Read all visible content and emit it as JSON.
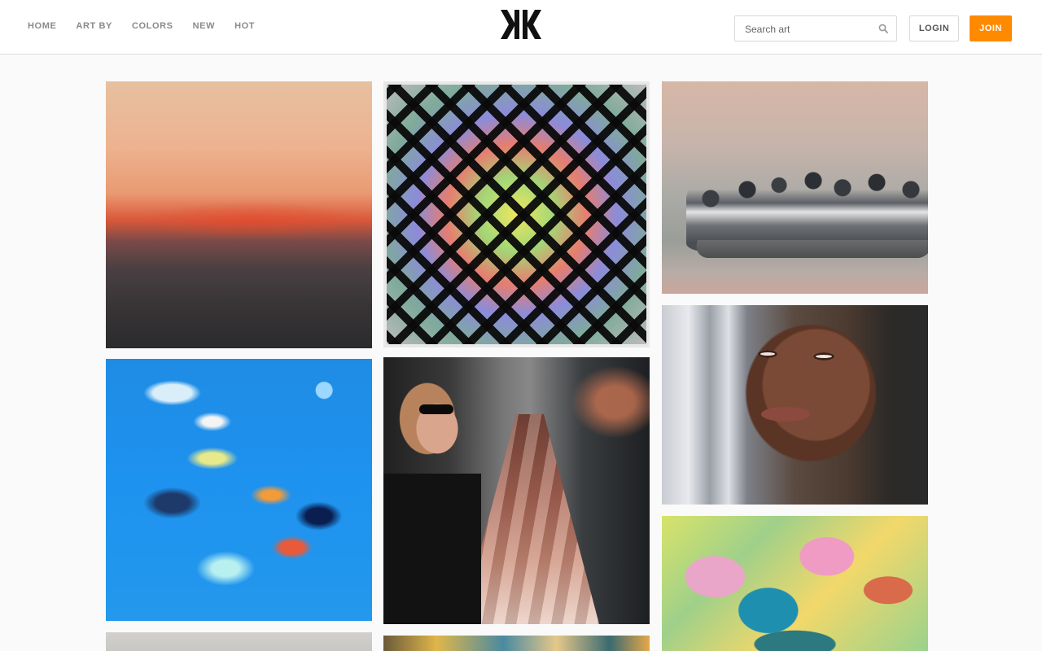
{
  "nav": {
    "items": [
      "HOME",
      "ART BY",
      "COLORS",
      "NEW",
      "HOT"
    ]
  },
  "logo": {
    "icon": "site-logo-mark"
  },
  "search": {
    "placeholder": "Search art",
    "value": "",
    "icon": "search-icon"
  },
  "actions": {
    "login": "LOGIN",
    "join": "JOIN"
  },
  "colors": {
    "accent": "#ff8a00",
    "nav_text": "#8a8a8a",
    "page_bg": "#fafafa"
  },
  "gallery": {
    "artworks": [
      {
        "subject": "sunset seascape painting"
      },
      {
        "subject": "rainbow geometric string art"
      },
      {
        "subject": "figures in a boat painting"
      },
      {
        "subject": "blue abstract figures painting"
      },
      {
        "subject": "woman with sunglasses and hallway painting"
      },
      {
        "subject": "portrait of a woman painting"
      },
      {
        "subject": "colorful cubist face painting"
      },
      {
        "subject": "grey artwork (partially visible)"
      },
      {
        "subject": "colorful artwork (partially visible)"
      }
    ]
  }
}
